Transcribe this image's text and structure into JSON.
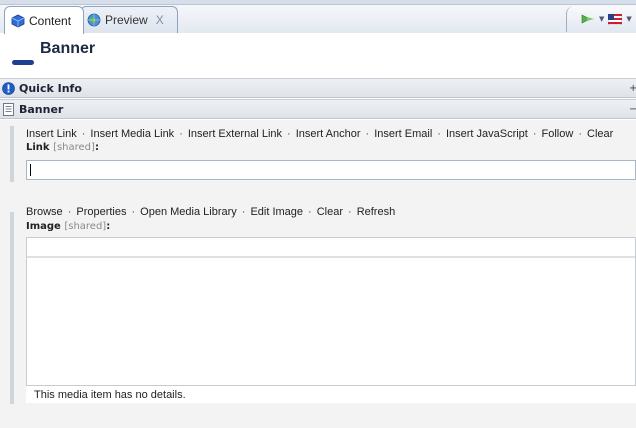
{
  "tabs": [
    {
      "label": "Content",
      "icon": "content-cube-icon",
      "active": true
    },
    {
      "label": "Preview",
      "icon": "globe-icon",
      "active": false,
      "close": "X"
    }
  ],
  "toolbar_right": {
    "icons": [
      "publish-arrow-icon",
      "language-flag-icon"
    ]
  },
  "header": {
    "title": "Banner",
    "icon": "banner-item-icon"
  },
  "sections": [
    {
      "label": "Quick Info",
      "icon": "info-icon",
      "toggle": "+"
    },
    {
      "label": "Banner",
      "icon": "page-icon",
      "toggle": "−"
    }
  ],
  "link_field": {
    "commands": [
      "Insert Link",
      "Insert Media Link",
      "Insert External Link",
      "Insert Anchor",
      "Insert Email",
      "Insert JavaScript",
      "Follow",
      "Clear"
    ],
    "label": "Link",
    "shared": "[shared]",
    "colon": ":",
    "value": ""
  },
  "image_field": {
    "commands": [
      "Browse",
      "Properties",
      "Open Media Library",
      "Edit Image",
      "Clear",
      "Refresh"
    ],
    "label": "Image",
    "shared": "[shared]",
    "colon": ":",
    "details": "This media item has no details."
  },
  "colors": {
    "accent": "#1e3f8f",
    "section_bg": "#dfe3e8",
    "body_bg": "#f3f3f3"
  }
}
